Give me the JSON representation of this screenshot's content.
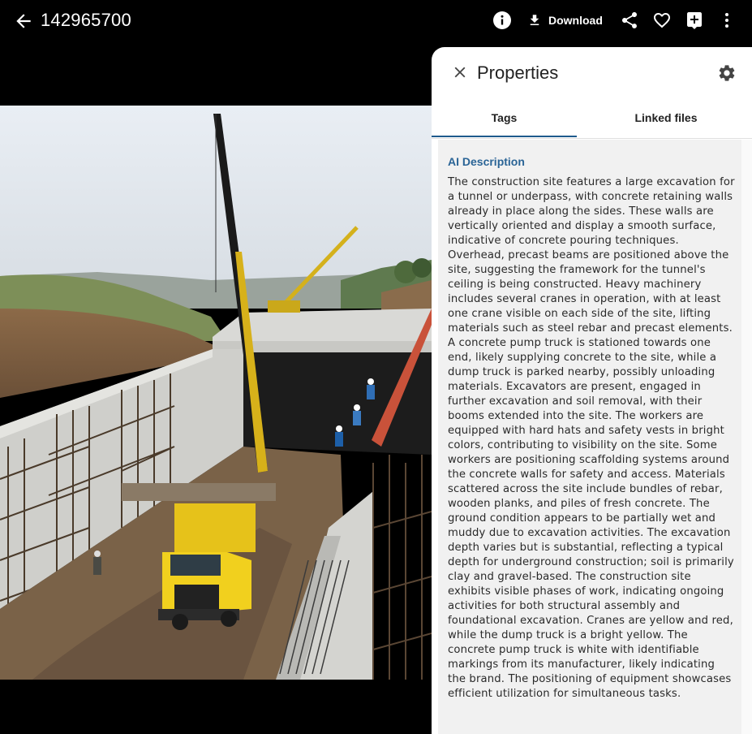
{
  "header": {
    "title": "142965700",
    "download_label": "Download"
  },
  "icons": {
    "back": "arrow-left-icon",
    "info": "info-icon",
    "download": "download-icon",
    "share": "share-icon",
    "favorite": "heart-icon",
    "add": "add-box-icon",
    "more": "more-vert-icon",
    "close": "close-icon",
    "settings": "gear-icon"
  },
  "panel": {
    "title": "Properties",
    "tabs": [
      {
        "label": "Tags",
        "active": true
      },
      {
        "label": "Linked files",
        "active": false
      }
    ],
    "section_label": "AI Description",
    "description": "The construction site features a large excavation for a tunnel or underpass, with concrete retaining walls already in place along the sides. These walls are vertically oriented and display a smooth surface, indicative of concrete pouring techniques. Overhead, precast beams are positioned above the site, suggesting the framework for the tunnel's ceiling is being constructed. Heavy machinery includes several cranes in operation, with at least one crane visible on each side of the site, lifting materials such as steel rebar and precast elements. A concrete pump truck is stationed towards one end, likely supplying concrete to the site, while a dump truck is parked nearby, possibly unloading materials. Excavators are present, engaged in further excavation and soil removal, with their booms extended into the site. The workers are equipped with hard hats and safety vests in bright colors, contributing to visibility on the site. Some workers are positioning scaffolding systems around the concrete walls for safety and access. Materials scattered across the site include bundles of rebar, wooden planks, and piles of fresh concrete. The ground condition appears to be partially wet and muddy due to excavation activities. The excavation depth varies but is substantial, reflecting a typical depth for underground construction; soil is primarily clay and gravel-based. The construction site exhibits visible phases of work, indicating ongoing activities for both structural assembly and foundational excavation. Cranes are yellow and red, while the dump truck is a bright yellow. The concrete pump truck is white with identifiable markings from its manufacturer, likely indicating the brand. The positioning of equipment showcases efficient utilization for simultaneous tasks."
  },
  "colors": {
    "accent": "#1e5a8c",
    "section_label": "#2a6496",
    "background": "#000000",
    "panel": "#ffffff"
  }
}
